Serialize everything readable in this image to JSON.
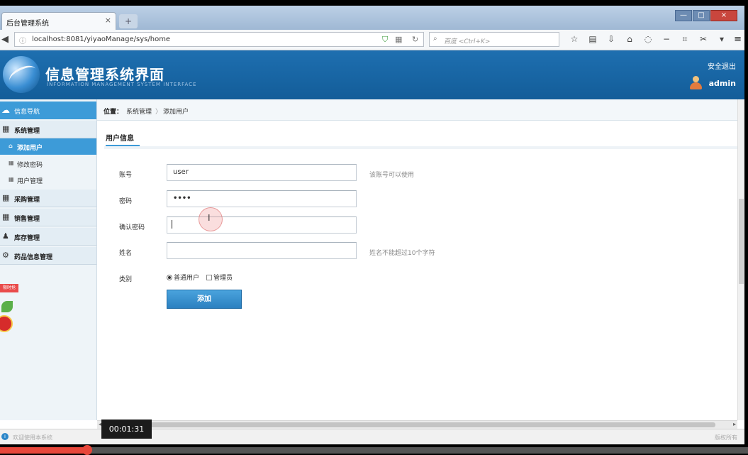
{
  "browser": {
    "tab_title": "后台管理系统",
    "tab_close": "×",
    "new_tab": "+",
    "url": "localhost:8081/yiyaoManage/sys/home",
    "search_placeholder": "百度 <Ctrl+K>",
    "window_buttons": [
      "—",
      "□",
      "×"
    ]
  },
  "header": {
    "title": "信息管理系统界面",
    "subtitle": "INFORMATION MANAGEMENT SYSTEM INTERFACE",
    "logout": "安全退出",
    "username": "admin"
  },
  "sidebar": {
    "head": "信息导航",
    "menus": [
      {
        "label": "系统管理",
        "icon": "calendar-icon"
      },
      {
        "label": "采购管理",
        "icon": "calendar-icon"
      },
      {
        "label": "销售管理",
        "icon": "calendar-icon"
      },
      {
        "label": "库存管理",
        "icon": "users-icon"
      },
      {
        "label": "药品信息管理",
        "icon": "gears-icon"
      }
    ],
    "subitems": [
      {
        "label": "添加用户",
        "active": true
      },
      {
        "label": "修改密码",
        "active": false
      },
      {
        "label": "用户管理",
        "active": false
      }
    ],
    "ad_tag": "限时抢"
  },
  "main": {
    "breadcrumb_label": "位置：",
    "breadcrumb_1": "系统管理",
    "breadcrumb_sep": "〉",
    "breadcrumb_2": "添加用户",
    "section_tab": "用户信息",
    "form": {
      "account_label": "账号",
      "account_value": "user",
      "account_hint": "该账号可以使用",
      "password_label": "密码",
      "password_value": "••••",
      "confirm_label": "确认密码",
      "confirm_value": "",
      "name_label": "姓名",
      "name_value": "",
      "name_hint": "姓名不能超过10个字符",
      "type_label": "类别",
      "type_option_1": "普通用户",
      "type_option_2": "管理员",
      "type_selected": "普通用户",
      "submit_label": "添加"
    }
  },
  "status": {
    "left": "欢迎使用本系统",
    "right": "版权所有"
  },
  "video": {
    "timestamp": "00:01:31",
    "progress": 0.117
  },
  "colors": {
    "header": "#135d99",
    "accent": "#3d9bd8",
    "progress": "#e8473b"
  }
}
